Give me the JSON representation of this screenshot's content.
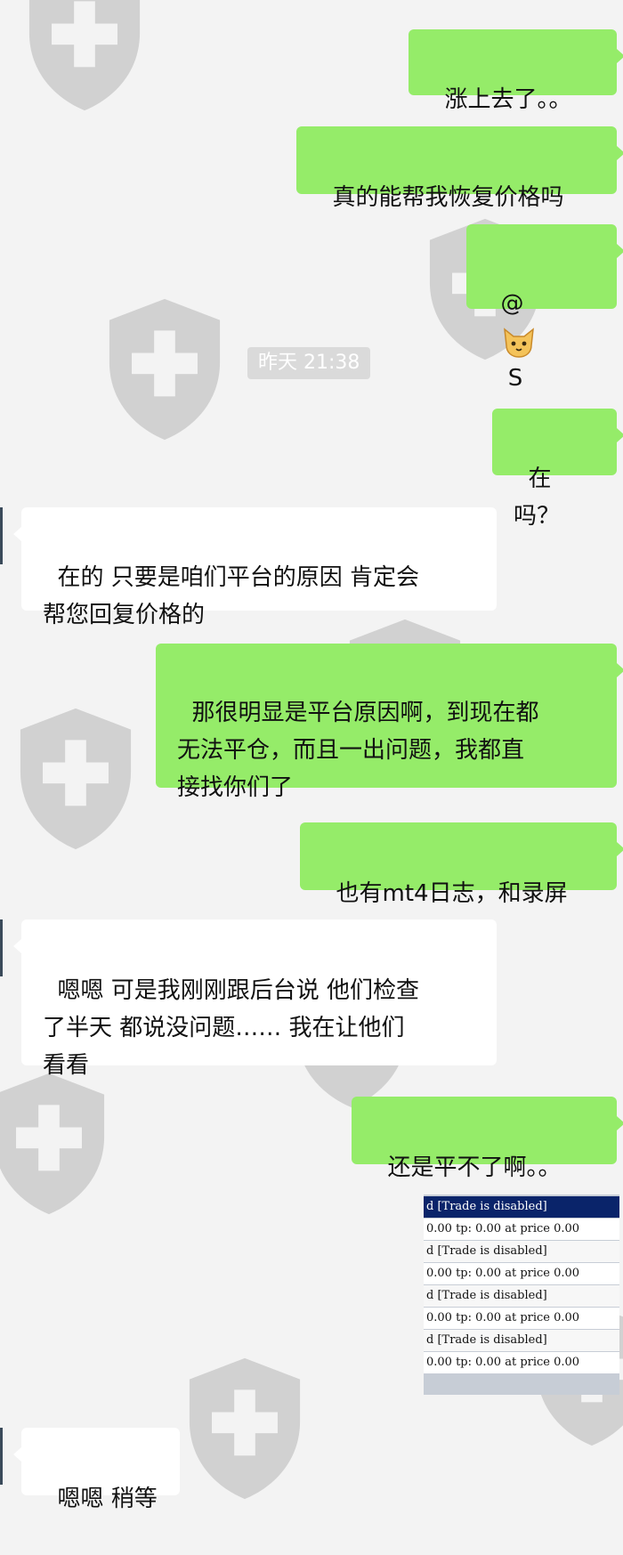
{
  "colors": {
    "sent_bubble": "#95ec69",
    "received_bubble": "#ffffff",
    "background": "#f3f3f3",
    "watermark": "#cfcfcf",
    "log_highlight": "#0a246a"
  },
  "watermark_icon": "shield-cross-icon",
  "timestamp": "昨天 21:38",
  "messages": [
    {
      "side": "sent",
      "text": "涨上去了。。"
    },
    {
      "side": "sent",
      "text": "真的能帮我恢复价格吗"
    },
    {
      "side": "sent",
      "text_before": "@ ",
      "emoji": "cat-face-icon",
      "text_after": " S"
    },
    {
      "side": "sent",
      "text": "在吗？"
    },
    {
      "side": "received",
      "text": "在的 只要是咱们平台的原因 肯定会\n帮您回复价格的"
    },
    {
      "side": "sent",
      "text": "那很明显是平台原因啊，到现在都\n无法平仓，而且一出问题，我都直\n接找你们了"
    },
    {
      "side": "sent",
      "text": "也有mt4日志，和录屏"
    },
    {
      "side": "received",
      "text": "嗯嗯 可是我刚刚跟后台说 他们检查\n了半天 都说没问题…… 我在让他们\n看看"
    },
    {
      "side": "sent",
      "text": "还是平不了啊。。"
    },
    {
      "side": "received",
      "text": "嗯嗯 稍等"
    }
  ],
  "screenshot_log": [
    "d [Trade is disabled]",
    "0.00 tp: 0.00 at price 0.00",
    "d [Trade is disabled]",
    "0.00 tp: 0.00 at price 0.00",
    "d [Trade is disabled]",
    "0.00 tp: 0.00 at price 0.00",
    "d [Trade is disabled]",
    "0.00 tp: 0.00 at price 0.00"
  ]
}
